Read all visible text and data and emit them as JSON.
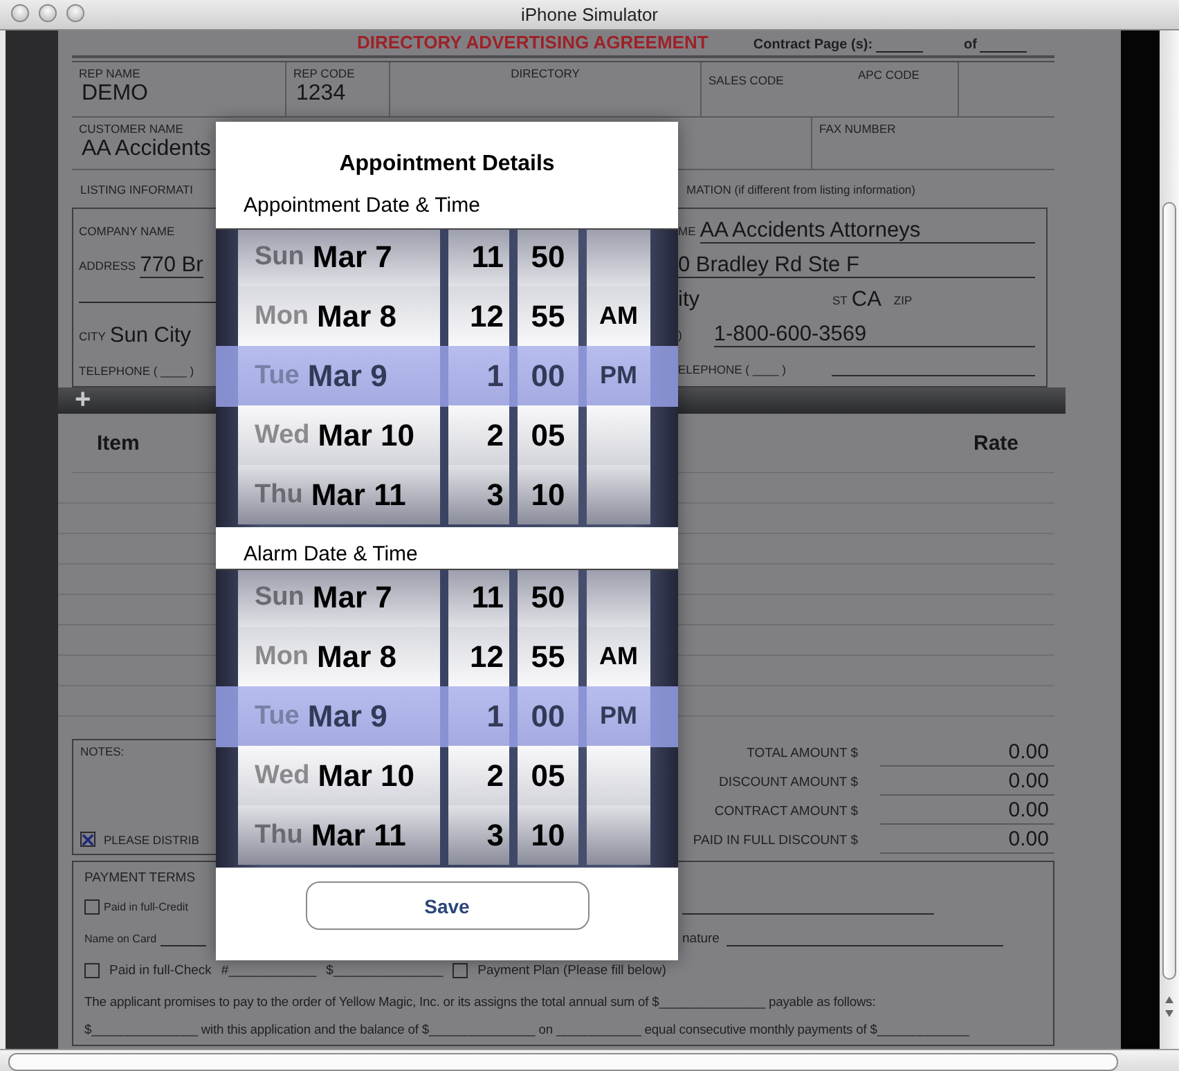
{
  "window": {
    "title": "iPhone Simulator"
  },
  "form": {
    "heading": "DIRECTORY ADVERTISING AGREEMENT",
    "contract_page": "Contract Page (s):",
    "contract_of": "of",
    "row1": [
      {
        "label": "REP NAME",
        "value": "DEMO"
      },
      {
        "label": "REP CODE",
        "value": "1234"
      },
      {
        "label": "DIRECTORY"
      },
      {
        "label": "SALES CODE"
      },
      {
        "label": "APC CODE"
      }
    ],
    "customer": {
      "label": "CUSTOMER NAME",
      "value": "AA Accidents"
    },
    "fax": {
      "label": "FAX NUMBER"
    },
    "listing_left": "LISTING INFORMATI",
    "listing_right": "MATION (if different from listing information)",
    "left_lines": {
      "company_label": "COMPANY NAME",
      "address_label": "ADDRESS",
      "address_value": "770 Br",
      "city_label": "CITY",
      "city_value": "Sun City",
      "telephone": "TELEPHONE ( ____ )"
    },
    "right_lines": {
      "name_label": "ME",
      "name_value": "AA Accidents Attorneys",
      "address_value": "0 Bradley Rd Ste F",
      "city_value": "ity",
      "state_label": "ST",
      "state_value": "CA",
      "zip_label": "ZIP",
      "phone_paren": ")",
      "phone_value": "1-800-600-3569",
      "telephone": "ELEPHONE ( ____ )"
    },
    "add_icon": "+",
    "table": {
      "columns": [
        "Item",
        "Rate"
      ]
    },
    "notes": {
      "label": "NOTES:",
      "distribute": {
        "checked": true,
        "label": "PLEASE DISTRIB"
      }
    },
    "totals": [
      {
        "label": "TOTAL AMOUNT $",
        "value": "0.00"
      },
      {
        "label": "DISCOUNT AMOUNT $",
        "value": "0.00"
      },
      {
        "label": "CONTRACT AMOUNT $",
        "value": "0.00"
      },
      {
        "label": "PAID IN FULL DISCOUNT $",
        "value": "0.00"
      }
    ],
    "payment": {
      "title": "PAYMENT TERMS",
      "credit": {
        "checked": false,
        "label": "Paid in full-Credit"
      },
      "name_on_card": "Name on Card",
      "signature": "nature",
      "check": {
        "checked": false,
        "label": "Paid in full-Check",
        "number": "#____________",
        "amount": "$_______________"
      },
      "plan": {
        "checked": false,
        "label": "Payment Plan (Please fill below)"
      },
      "terms": [
        "The applicant promises to pay to the order of Yellow Magic, Inc. or its assigns the total annual sum of $_______________ payable as follows:",
        "$_______________ with this application and the balance of $_______________ on ____________ equal consecutive monthly payments of $_____________"
      ]
    }
  },
  "dialog": {
    "title": "Appointment Details",
    "pickers": [
      {
        "label": "Appointment Date & Time",
        "rows": [
          {
            "weekday": "Sun",
            "date": "Mar 7",
            "hour": "11",
            "minute": "50",
            "selected": false
          },
          {
            "weekday": "Mon",
            "date": "Mar 8",
            "hour": "12",
            "minute": "55",
            "meridiem": "AM",
            "selected": false
          },
          {
            "weekday": "Tue",
            "date": "Mar 9",
            "hour": "1",
            "minute": "00",
            "meridiem": "PM",
            "selected": true
          },
          {
            "weekday": "Wed",
            "date": "Mar 10",
            "hour": "2",
            "minute": "05",
            "selected": false
          },
          {
            "weekday": "Thu",
            "date": "Mar 11",
            "hour": "3",
            "minute": "10",
            "selected": false
          }
        ]
      },
      {
        "label": "Alarm Date & Time",
        "rows": [
          {
            "weekday": "Sun",
            "date": "Mar 7",
            "hour": "11",
            "minute": "50",
            "selected": false
          },
          {
            "weekday": "Mon",
            "date": "Mar 8",
            "hour": "12",
            "minute": "55",
            "meridiem": "AM",
            "selected": false
          },
          {
            "weekday": "Tue",
            "date": "Mar 9",
            "hour": "1",
            "minute": "00",
            "meridiem": "PM",
            "selected": true
          },
          {
            "weekday": "Wed",
            "date": "Mar 10",
            "hour": "2",
            "minute": "05",
            "selected": false
          },
          {
            "weekday": "Thu",
            "date": "Mar 11",
            "hour": "3",
            "minute": "10",
            "selected": false
          }
        ]
      }
    ],
    "save": "Save"
  }
}
